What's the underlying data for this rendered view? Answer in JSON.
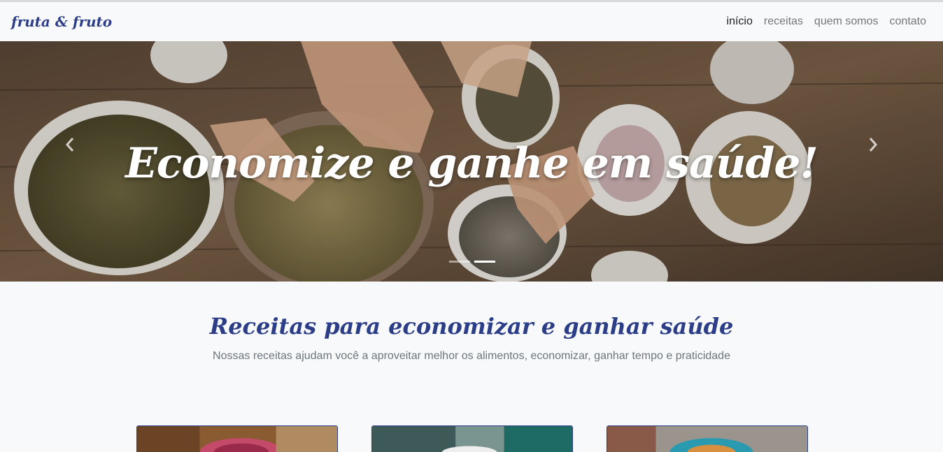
{
  "navbar": {
    "brand": "fruta & fruto",
    "links": [
      {
        "label": "início",
        "active": true
      },
      {
        "label": "receitas",
        "active": false
      },
      {
        "label": "quem somos",
        "active": false
      },
      {
        "label": "contato",
        "active": false
      }
    ]
  },
  "hero": {
    "title": "Economize e ganhe em saúde!",
    "prev_icon": "chevron-left-icon",
    "next_icon": "chevron-right-icon",
    "slide_count": 2,
    "active_slide": 2
  },
  "recipes": {
    "title": "Receitas para economizar e ganhar saúde",
    "subtitle": "Nossas receitas ajudam você a aproveitar melhor os alimentos, economizar, ganhar tempo e praticidade"
  },
  "colors": {
    "brand": "#2c3e87",
    "background": "#f8f9fa",
    "nav_text": "#777777",
    "nav_active": "#222222"
  }
}
